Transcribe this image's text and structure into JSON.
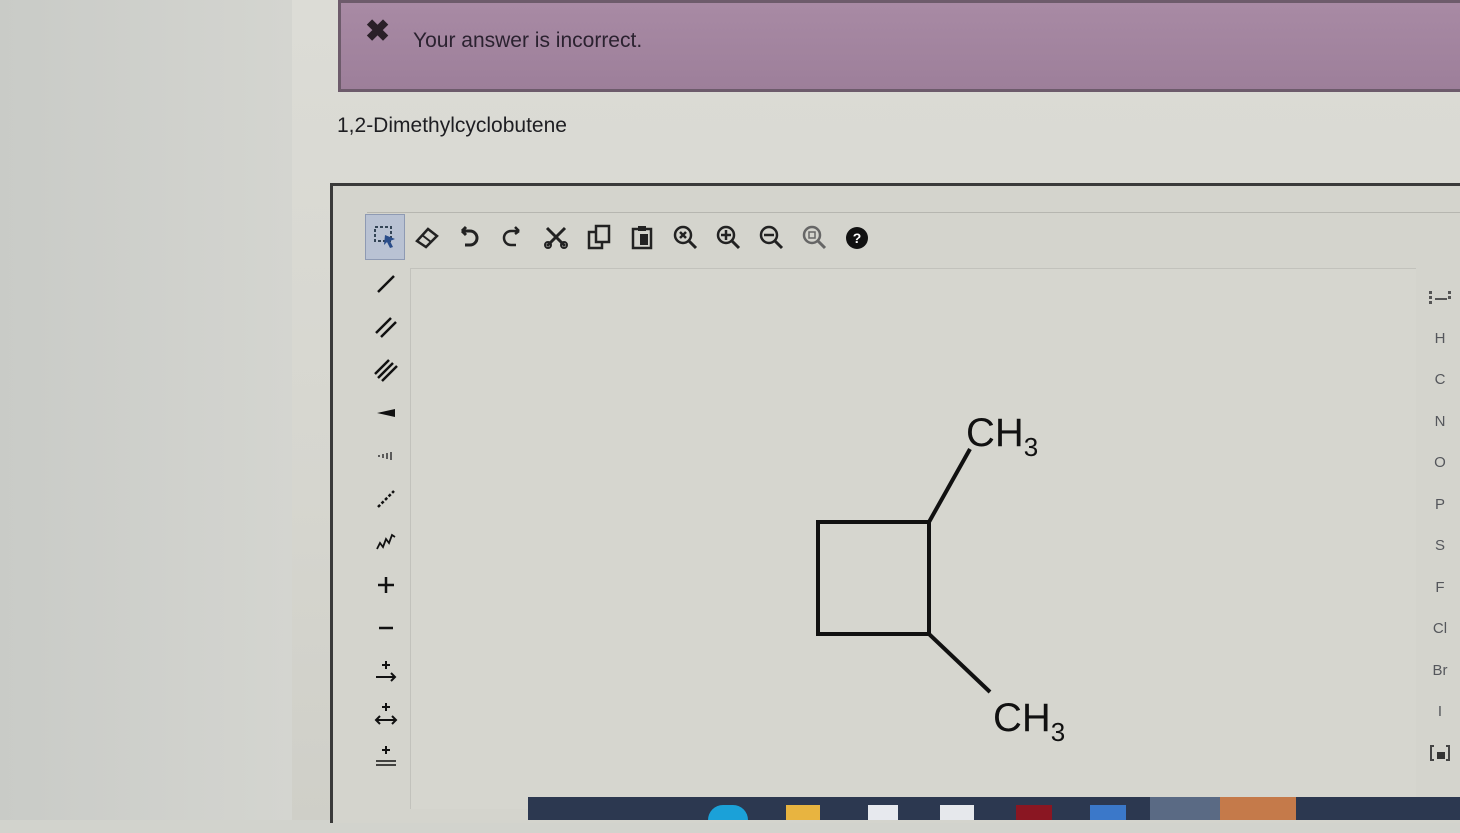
{
  "alert": {
    "icon": "close-x-icon",
    "message": "Your answer is incorrect."
  },
  "question": {
    "title": "1,2-Dimethylcyclobutene"
  },
  "toolbar": {
    "buttons": [
      "select-icon",
      "erase-icon",
      "undo-icon",
      "redo-icon",
      "cut-icon",
      "copy-icon",
      "paste-icon",
      "zoom-reset-icon",
      "zoom-in-icon",
      "zoom-out-icon",
      "zoom-fit-icon",
      "help-icon"
    ]
  },
  "side_tools": [
    "single-bond-icon",
    "double-bond-icon",
    "triple-bond-icon",
    "wedge-bond-icon",
    "hash-bond-icon",
    "dashed-bond-icon",
    "wavy-bond-icon",
    "positive-charge-icon",
    "negative-charge-icon",
    "reaction-arrow-icon",
    "equilibrium-arrow-icon",
    "retro-arrow-icon"
  ],
  "atoms": [
    "H",
    "C",
    "N",
    "O",
    "P",
    "S",
    "F",
    "Cl",
    "Br",
    "I"
  ],
  "molecule": {
    "top_group": {
      "main": "CH",
      "sub": "3"
    },
    "bottom_group": {
      "main": "CH",
      "sub": "3"
    }
  },
  "colors": {
    "alert_bg": "#a88aa4",
    "select_active": "#b9c2d3"
  }
}
